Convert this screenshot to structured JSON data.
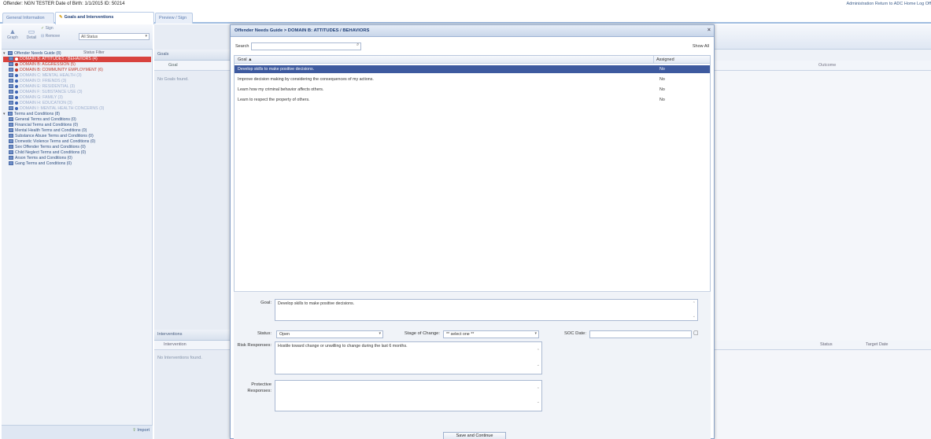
{
  "header": {
    "offender_info": "Offender: NGN TESTER   Date of Birth: 1/1/2015   ID: 50214",
    "top_links": "Administration  Return to ADC Home  Log Off"
  },
  "tabs": [
    {
      "label": "General Information"
    },
    {
      "label": "Goals and Interventions",
      "icon": "pencil-icon"
    },
    {
      "label": "Preview / Sign"
    }
  ],
  "left_toolbar": {
    "graph": "Graph",
    "detail": "Detail",
    "sign": "Sign",
    "remove": "Remove",
    "status_filter_label": "Status Filter",
    "status_filter_value": "All Status"
  },
  "tree": {
    "root": "Offender Needs Guide (8)",
    "domains": [
      {
        "label": "DOMAIN B: ATTITUDES / BEHAVIORS (4)",
        "state": "selected",
        "dot": "#ffffff"
      },
      {
        "label": "DOMAIN B: AGGRESSION (5)",
        "state": "red",
        "dot": "#c0392b"
      },
      {
        "label": "DOMAIN B: COMMUNITY EMPLOYMENT (6)",
        "state": "red",
        "dot": "#c0392b"
      },
      {
        "label": "DOMAIN C: MENTAL HEALTH (3)",
        "state": "faded",
        "dot": "#3d64b5"
      },
      {
        "label": "DOMAIN D: FRIENDS (3)",
        "state": "faded",
        "dot": "#3d64b5"
      },
      {
        "label": "DOMAIN E: RESIDENTIAL (3)",
        "state": "faded",
        "dot": "#3d64b5"
      },
      {
        "label": "DOMAIN F: SUBSTANCE USE (3)",
        "state": "faded",
        "dot": "#3d64b5"
      },
      {
        "label": "DOMAIN G: FAMILY (3)",
        "state": "faded",
        "dot": "#3d64b5"
      },
      {
        "label": "DOMAIN H: EDUCATION (3)",
        "state": "faded",
        "dot": "#3d64b5"
      },
      {
        "label": "DOMAIN I: MENTAL HEALTH CONCERNS (3)",
        "state": "faded",
        "dot": "#3d64b5"
      }
    ],
    "terms_root": "Terms and Conditions (8)",
    "terms": [
      "General Terms and Conditions (0)",
      "Financial Terms and Conditions (0)",
      "Mental Health Terms and Conditions (0)",
      "Substance Abuse Terms and Conditions (0)",
      "Domestic Violence Terms and Conditions (0)",
      "Sex Offender Terms and Conditions (0)",
      "Child Neglect Terms and Conditions (0)",
      "Arson Terms and Conditions (0)",
      "Gang Terms and Conditions (0)"
    ],
    "import_label": "Import"
  },
  "goals_panel": {
    "header": "Goals",
    "column": "Goal",
    "empty": "No Goals found."
  },
  "interventions_panel": {
    "header": "Interventions",
    "column": "Intervention",
    "empty": "No Interventions found.",
    "col_status": "Status",
    "col_target": "Target Date"
  },
  "outcome_col": "Outcome",
  "dialog": {
    "title": "Offender Needs Guide > DOMAIN B: ATTITUDES / BEHAVIORS",
    "close": "×",
    "search_label": "Search",
    "search_value": "",
    "show_all": "Show All",
    "grid_col_goal": "Goal ▲",
    "grid_col_assigned": "Assigned",
    "rows": [
      {
        "goal": "Develop skills to make positive decisions.",
        "assigned": "No",
        "selected": true
      },
      {
        "goal": "Improve decision making by considering the consequences of my actions.",
        "assigned": "No",
        "selected": false
      },
      {
        "goal": "Learn how my criminal behavior affects others.",
        "assigned": "No",
        "selected": false
      },
      {
        "goal": "Learn to respect the property of others.",
        "assigned": "No",
        "selected": false
      }
    ],
    "goal_label": "Goal:",
    "goal_value": "Develop skills to make positive decisions.",
    "status_label": "Status:",
    "status_value": "Open",
    "stage_label": "Stage of Change:",
    "stage_value": "** select one **",
    "soc_label": "SOC Date:",
    "soc_value": "",
    "risk_label": "Risk Responses:",
    "risk_value": "Hostile toward change or unwilling to change during the last 6 months.",
    "protective_label": "Protective Responses:",
    "protective_value": "",
    "save_label": "Save and Continue"
  }
}
